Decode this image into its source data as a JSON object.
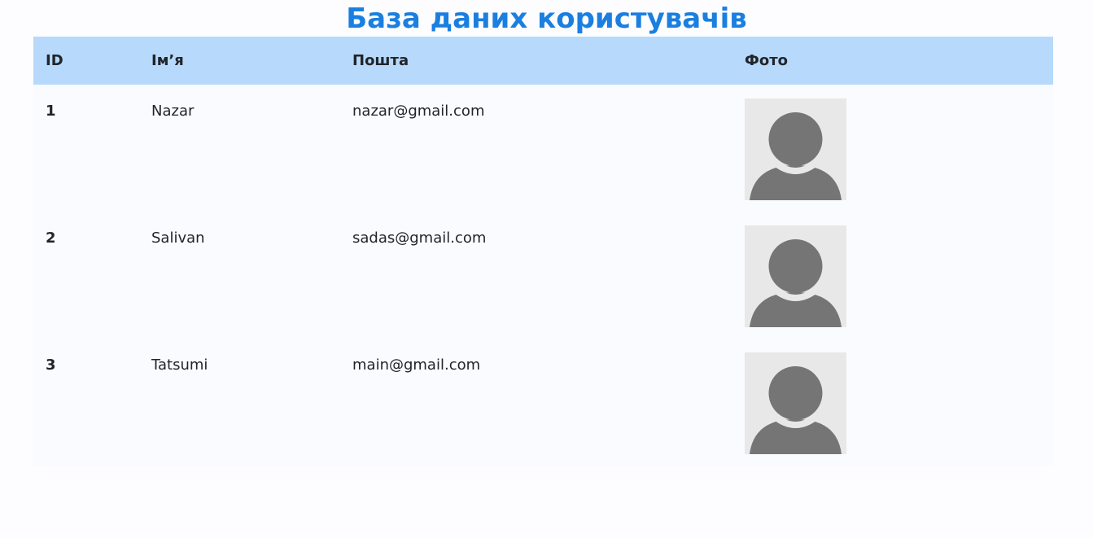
{
  "page": {
    "title": "База даних користувачів"
  },
  "table": {
    "headers": {
      "id": "ID",
      "name": "Ім’я",
      "email": "Пошта",
      "photo": "Фото"
    },
    "rows": [
      {
        "id": "1",
        "name": "Nazar",
        "email": "nazar@gmail.com",
        "photo": "user-avatar-placeholder"
      },
      {
        "id": "2",
        "name": "Salivan",
        "email": "sadas@gmail.com",
        "photo": "user-avatar-placeholder"
      },
      {
        "id": "3",
        "name": "Tatsumi",
        "email": "main@gmail.com",
        "photo": "user-avatar-placeholder"
      }
    ]
  },
  "colors": {
    "title": "#1a7fe0",
    "header_bg": "#b6d9fc",
    "avatar_bg": "#e8e8e8",
    "avatar_fg": "#757575"
  }
}
